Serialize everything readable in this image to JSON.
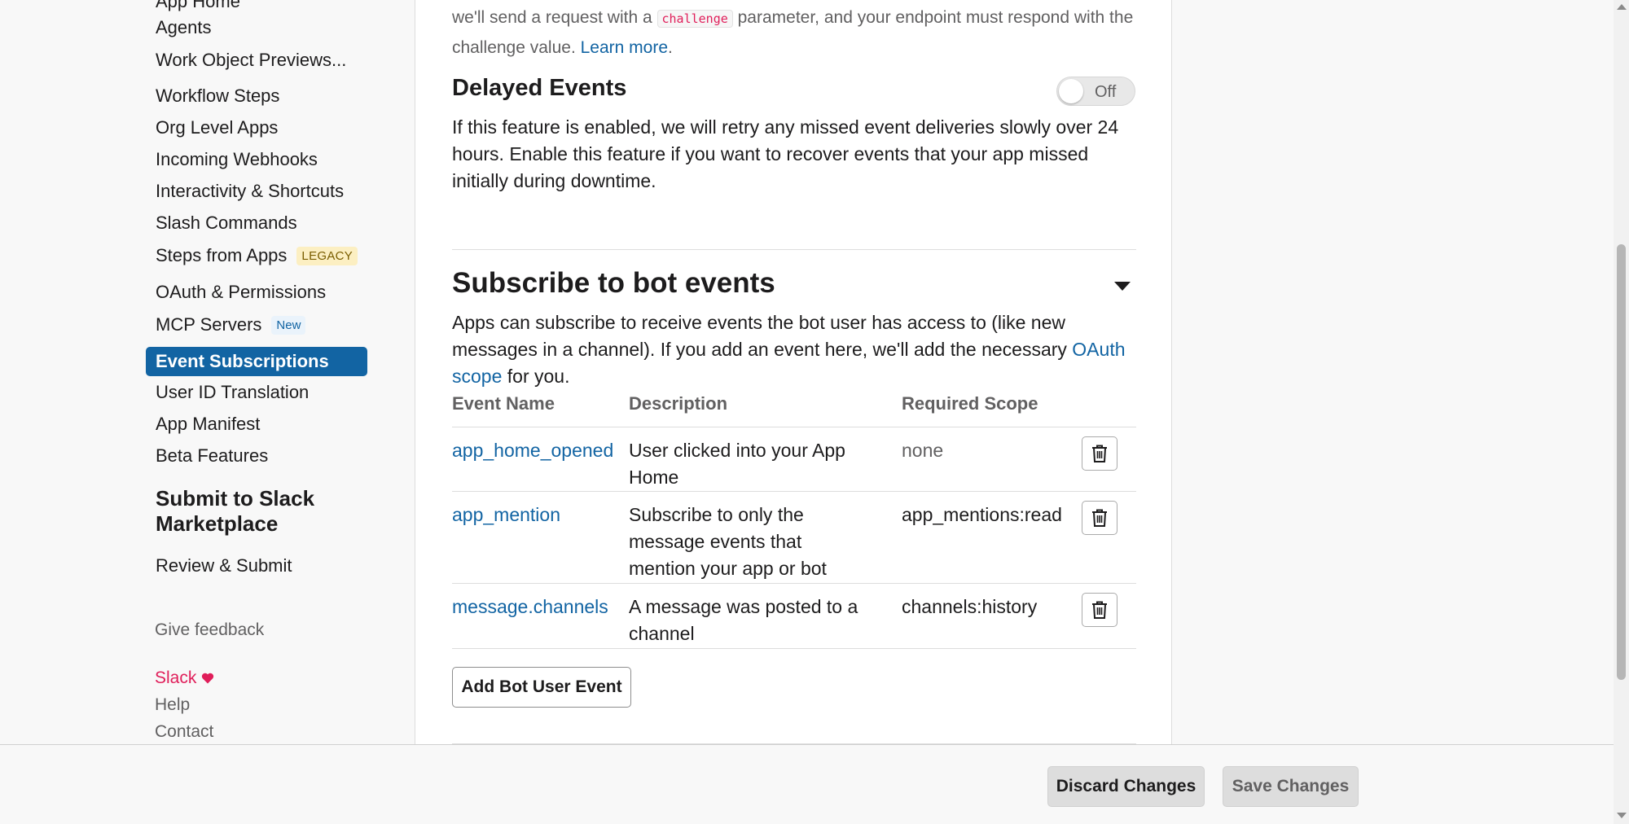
{
  "sidebar": {
    "items": [
      {
        "label": "App Home"
      },
      {
        "label": "Agents"
      },
      {
        "label": "Work Object Previews..."
      },
      {
        "label": "Workflow Steps"
      },
      {
        "label": "Org Level Apps"
      },
      {
        "label": "Incoming Webhooks"
      },
      {
        "label": "Interactivity & Shortcuts"
      },
      {
        "label": "Slash Commands"
      },
      {
        "label": "Steps from Apps",
        "badge": "LEGACY"
      },
      {
        "label": "OAuth & Permissions"
      },
      {
        "label": "MCP Servers",
        "badge": "New"
      },
      {
        "label": "Event Subscriptions"
      },
      {
        "label": "User ID Translation"
      },
      {
        "label": "App Manifest"
      },
      {
        "label": "Beta Features"
      }
    ],
    "submit_heading": "Submit to Slack Marketplace",
    "review_submit": "Review & Submit",
    "give_feedback": "Give feedback",
    "footer": {
      "slack": "Slack",
      "help": "Help",
      "contact": "Contact"
    }
  },
  "main": {
    "intro": {
      "prefix": "we'll send a request with a",
      "code": "challenge",
      "suffix": "parameter, and your endpoint must respond with the challenge value.",
      "link": "Learn more",
      "end": "."
    },
    "delayed_events": {
      "title": "Delayed Events",
      "toggle_label": "Off",
      "enabled": false,
      "description": "If this feature is enabled, we will retry any missed event deliveries slowly over 24 hours. Enable this feature if you want to recover events that your app missed initially during downtime."
    },
    "bot_events": {
      "title": "Subscribe to bot events",
      "description_prefix": "Apps can subscribe to receive events the bot user has access to (like new messages in a channel). If you add an event here, we'll add the necessary",
      "description_link": "OAuth scope",
      "description_suffix": "for you.",
      "columns": [
        "Event Name",
        "Description",
        "Required Scope"
      ],
      "rows": [
        {
          "event": "app_home_opened",
          "description": "User clicked into your App Home",
          "scope": "none"
        },
        {
          "event": "app_mention",
          "description": "Subscribe to only the message events that mention your app or bot",
          "scope": "app_mentions:read"
        },
        {
          "event": "message.channels",
          "description": "A message was posted to a channel",
          "scope": "channels:history"
        }
      ],
      "add_button": "Add Bot User Event"
    }
  },
  "bottom_bar": {
    "discard": "Discard Changes",
    "save": "Save Changes"
  },
  "colors": {
    "accent": "#1264a3",
    "slack_pink": "#e01e5a"
  }
}
